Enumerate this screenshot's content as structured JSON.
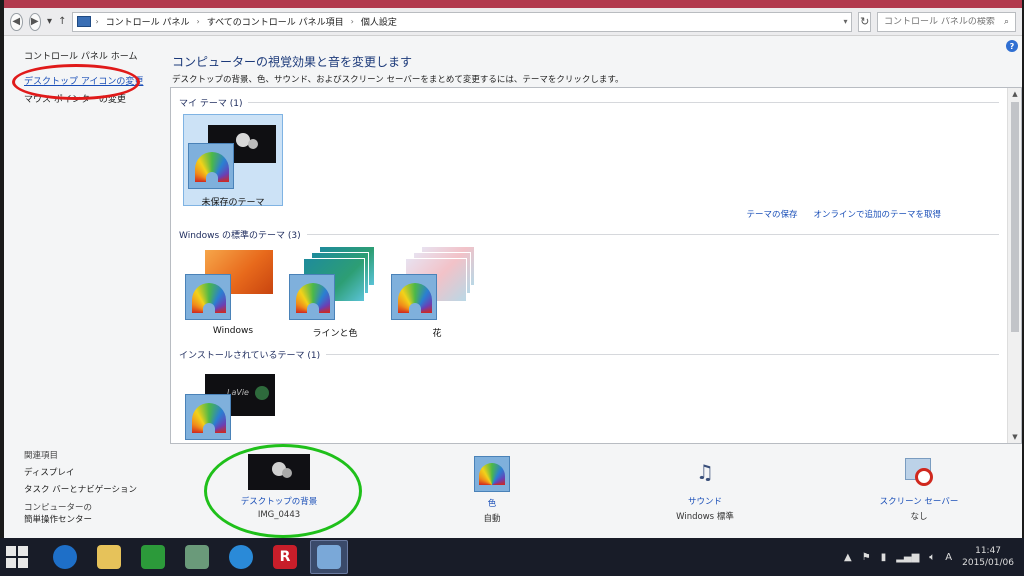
{
  "address_bar": {
    "crumbs": [
      "コントロール パネル",
      "すべてのコントロール パネル項目",
      "個人設定"
    ],
    "search_placeholder": "コントロール パネルの検索"
  },
  "left_pane": {
    "home": "コントロール パネル ホーム",
    "link_desktop_icons": "デスクトップ アイコンの変更",
    "link_mouse_pointers": "マウス ポインターの変更",
    "see_also_title": "関連項目",
    "see_also": [
      "ディスプレイ",
      "タスク バーとナビゲーション",
      "コンピューターの",
      "簡単操作センター"
    ]
  },
  "main": {
    "title": "コンピューターの視覚効果と音を変更します",
    "description": "デスクトップの背景、色、サウンド、およびスクリーン セーバーをまとめて変更するには、テーマをクリックします。",
    "my_themes_header": "マイ テーマ (1)",
    "unsaved_theme": "未保存のテーマ",
    "save_theme": "テーマの保存",
    "get_more_online": "オンラインで追加のテーマを取得",
    "windows_themes_header": "Windows の標準のテーマ (3)",
    "windows_themes": [
      "Windows",
      "ラインと色",
      "花"
    ],
    "installed_themes_header": "インストールされているテーマ (1)",
    "lavie_text": "LaVie"
  },
  "bottom": {
    "background_label": "デスクトップの背景",
    "background_value": "IMG_0443",
    "color_label": "色",
    "color_value": "自動",
    "sound_label": "サウンド",
    "sound_value": "Windows 標準",
    "screensaver_label": "スクリーン セーバー",
    "screensaver_value": "なし"
  },
  "taskbar": {
    "ime": "A",
    "time": "11:47",
    "date": "2015/01/06",
    "app_r": "R"
  },
  "colors": {
    "accent_link": "#1a4fb8",
    "red_annotation": "#e01a1a",
    "green_annotation": "#1fc01a"
  }
}
